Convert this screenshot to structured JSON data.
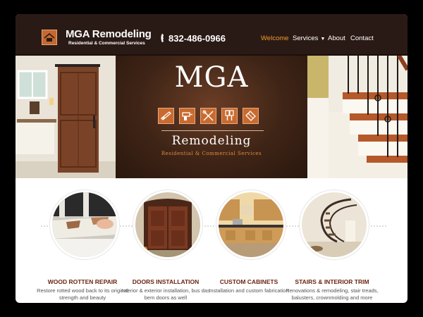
{
  "header": {
    "brand": "MGA Remodeling",
    "brand_sub": "Residential & Commercial Services",
    "phone": "832-486-0966",
    "nav": [
      {
        "label": "Welcome",
        "active": true
      },
      {
        "label": "Services",
        "dropdown": true
      },
      {
        "label": "About"
      },
      {
        "label": "Contact"
      }
    ]
  },
  "hero": {
    "logo_text": "MGA",
    "remodeling": "Remodeling",
    "tagline": "Residential & Commercial Services",
    "icon_names": [
      "saw-icon",
      "drill-icon",
      "tools-icon",
      "paintbrush-icon",
      "tile-icon"
    ]
  },
  "services": [
    {
      "title": "WOOD ROTTEN REPAIR",
      "desc": "Restore rotted wood back to its original strength and beauty"
    },
    {
      "title": "DOORS INSTALLATION",
      "desc": "Interior & exterior installation, bus das bem doors as well"
    },
    {
      "title": "CUSTOM CABINETS",
      "desc": "Installation and custom fabrication"
    },
    {
      "title": "STAIRS & INTERIOR TRIM",
      "desc": "Renovations & remodeling, stair treads, balusters, crownmolding and more"
    }
  ],
  "colors": {
    "header_bg": "#2a1a15",
    "accent": "#f29a2e",
    "icon_tile": "#c96b30",
    "service_title": "#6a2613"
  }
}
